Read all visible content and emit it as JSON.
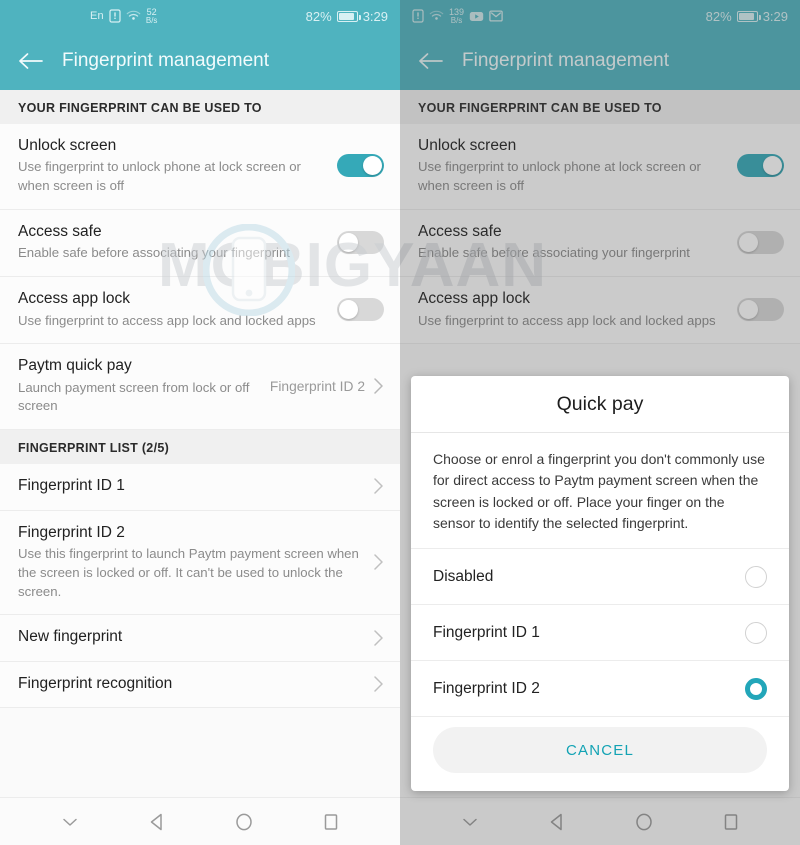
{
  "theme": {
    "accent": "#4fb3bf",
    "toggle_on": "#35a9b8",
    "radio_selected": "#22a6b9",
    "cancel_text": "#13a3b4",
    "section_bg": "#f0f0f0"
  },
  "watermark": {
    "text": "MOBIGYAAN"
  },
  "left_phone": {
    "statusbar": {
      "language": "En",
      "sim_icon": "sim-alert-icon",
      "wifi_icon": "wifi-icon",
      "data_rate_value": "52",
      "data_rate_unit": "B/s",
      "battery_percent": "82%",
      "battery_icon": "battery-icon",
      "clock": "3:29"
    },
    "appbar": {
      "back_icon": "back-arrow-icon",
      "title": "Fingerprint management"
    },
    "sections": [
      {
        "header": "YOUR FINGERPRINT CAN BE USED TO",
        "rows": [
          {
            "title": "Unlock screen",
            "subtitle": "Use fingerprint to unlock phone at lock screen or when screen is off",
            "control": "toggle",
            "toggle_state": "on"
          },
          {
            "title": "Access safe",
            "subtitle": "Enable safe before associating your fingerprint",
            "control": "toggle",
            "toggle_state": "off"
          },
          {
            "title": "Access app lock",
            "subtitle": "Use fingerprint to access app lock and locked apps",
            "control": "toggle",
            "toggle_state": "off"
          },
          {
            "title": "Paytm quick pay",
            "subtitle": "Launch payment screen from lock or off screen",
            "control": "value-chevron",
            "value": "Fingerprint ID 2"
          }
        ]
      },
      {
        "header": "FINGERPRINT LIST (2/5)",
        "rows": [
          {
            "title": "Fingerprint ID 1",
            "subtitle": "",
            "control": "chevron"
          },
          {
            "title": "Fingerprint ID 2",
            "subtitle": "Use this fingerprint to launch Paytm payment screen when the screen is locked or off. It can't be used to unlock the screen.",
            "control": "chevron"
          },
          {
            "title": "New fingerprint",
            "subtitle": "",
            "control": "chevron"
          },
          {
            "title": "Fingerprint recognition",
            "subtitle": "",
            "control": "chevron"
          }
        ]
      }
    ],
    "navbar": {
      "hide_nav_icon": "chevron-down-icon",
      "back_icon": "triangle-back-icon",
      "home_icon": "circle-home-icon",
      "recents_icon": "square-recents-icon"
    }
  },
  "right_phone": {
    "statusbar": {
      "sim_icon": "sim-alert-icon",
      "wifi_icon": "wifi-icon",
      "data_rate_value": "139",
      "data_rate_unit": "B/s",
      "youtube_icon": "youtube-icon",
      "gmail_icon": "gmail-icon",
      "battery_percent": "82%",
      "battery_icon": "battery-icon",
      "clock": "3:29"
    },
    "appbar": {
      "back_icon": "back-arrow-icon",
      "title": "Fingerprint management"
    },
    "sections": [
      {
        "header": "YOUR FINGERPRINT CAN BE USED TO",
        "rows": [
          {
            "title": "Unlock screen",
            "subtitle": "Use fingerprint to unlock phone at lock screen or when screen is off",
            "control": "toggle",
            "toggle_state": "on"
          },
          {
            "title": "Access safe",
            "subtitle": "Enable safe before associating your fingerprint",
            "control": "toggle",
            "toggle_state": "off"
          },
          {
            "title": "Access app lock",
            "subtitle": "Use fingerprint to access app lock and locked apps",
            "control": "toggle",
            "toggle_state": "off"
          }
        ]
      }
    ],
    "dialog": {
      "title": "Quick pay",
      "body": "Choose or enrol a fingerprint you don't commonly use for direct access to Paytm payment screen when the screen is locked or off. Place your finger on the sensor to identify the selected fingerprint.",
      "options": [
        {
          "label": "Disabled",
          "selected": false
        },
        {
          "label": "Fingerprint ID 1",
          "selected": false
        },
        {
          "label": "Fingerprint ID 2",
          "selected": true
        }
      ],
      "cancel_label": "CANCEL"
    },
    "navbar": {
      "hide_nav_icon": "chevron-down-icon",
      "back_icon": "triangle-back-icon",
      "home_icon": "circle-home-icon",
      "recents_icon": "square-recents-icon"
    }
  }
}
